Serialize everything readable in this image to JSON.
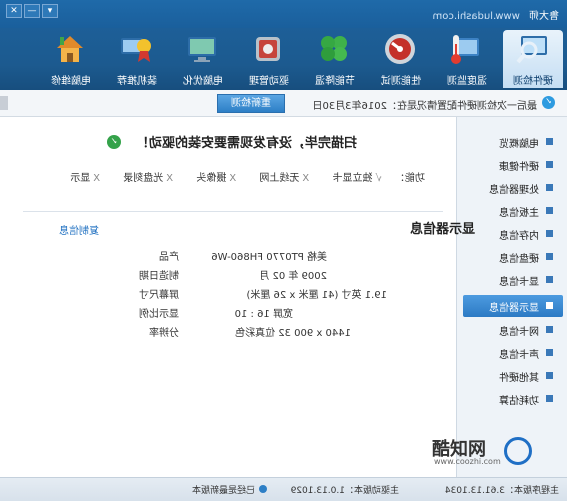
{
  "app": {
    "name": "鲁大师",
    "url": "www.ludashi.com",
    "window_controls": [
      "▾",
      "—",
      "✕"
    ]
  },
  "toolbar": [
    {
      "label": "硬件检测",
      "icon": "hardware-scan-icon",
      "active": true
    },
    {
      "label": "温度监测",
      "icon": "thermometer-icon",
      "active": false
    },
    {
      "label": "性能测试",
      "icon": "speedometer-icon",
      "active": false
    },
    {
      "label": "节能降温",
      "icon": "clover-icon",
      "active": false
    },
    {
      "label": "驱动管理",
      "icon": "drive-tools-icon",
      "active": false
    },
    {
      "label": "电脑优化",
      "icon": "monitor-optimize-icon",
      "active": false
    },
    {
      "label": "装机推荐",
      "icon": "award-computer-icon",
      "active": false
    },
    {
      "label": "电脑维修",
      "icon": "home-repair-icon",
      "active": false
    }
  ],
  "infobar": {
    "status": "最后一次检测硬件配置情况是在：2016年3月30日",
    "rescan_button": "重新检测"
  },
  "sidebar": [
    {
      "label": "电脑概览",
      "selected": false
    },
    {
      "label": "硬件健康",
      "selected": false
    },
    {
      "label": "处理器信息",
      "selected": false
    },
    {
      "label": "主板信息",
      "selected": false
    },
    {
      "label": "内存信息",
      "selected": false
    },
    {
      "label": "硬盘信息",
      "selected": false
    },
    {
      "label": "显卡信息",
      "selected": false
    },
    {
      "label": "显示器信息",
      "selected": true
    },
    {
      "label": "网卡信息",
      "selected": false
    },
    {
      "label": "声卡信息",
      "selected": false
    },
    {
      "label": "其他硬件",
      "selected": false
    },
    {
      "label": "功耗估算",
      "selected": false
    }
  ],
  "scan": {
    "title": "扫描完毕，没有发现需要安装的驱动！",
    "func_label": "功能：",
    "functions": [
      {
        "mark": "√",
        "label": "独立显卡"
      },
      {
        "mark": "X",
        "label": "无线上网"
      },
      {
        "mark": "X",
        "label": "摄像头"
      },
      {
        "mark": "X",
        "label": "光盘刻录"
      },
      {
        "mark": "X",
        "label": "显示"
      }
    ]
  },
  "monitor": {
    "title": "显示器信息",
    "copy_link": "复制信息",
    "fields": [
      {
        "key": "产品",
        "value": "美格 PT0770 FH860-W6"
      },
      {
        "key": "制造日期",
        "value": "2009 年 02 月"
      },
      {
        "key": "屏幕尺寸",
        "value": "19.1 英寸 (41 厘米 x 26 厘米)"
      },
      {
        "key": "显示比例",
        "value": "宽屏 16 : 10"
      },
      {
        "key": "分辨率",
        "value": "1440 x 900 32 位真彩色"
      }
    ]
  },
  "watermark": {
    "name": "酷知网",
    "url": "www.coozhi.com"
  },
  "statusbar": {
    "main_version": "主程序版本：3.61.13.1034",
    "driver_version": "主驱动版本：1.0.13.1029",
    "latest": "已经是最新版本"
  }
}
